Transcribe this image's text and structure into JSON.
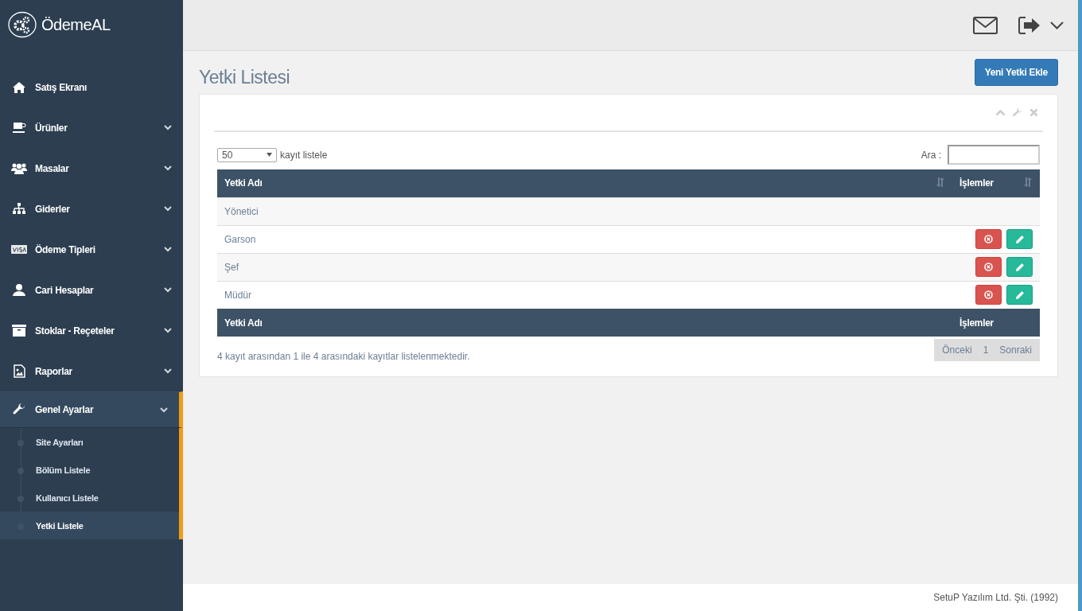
{
  "brand": "ÖdemeAL",
  "sidebar": {
    "items": [
      {
        "label": "Satış Ekranı"
      },
      {
        "label": "Ürünler",
        "expanded": false
      },
      {
        "label": "Masalar",
        "expanded": false
      },
      {
        "label": "Giderler",
        "expanded": false
      },
      {
        "label": "Ödeme Tipleri",
        "expanded": false
      },
      {
        "label": "Cari Hesaplar",
        "expanded": false
      },
      {
        "label": "Stoklar - Reçeteler",
        "expanded": false
      },
      {
        "label": "Raporlar",
        "expanded": false
      },
      {
        "label": "Genel Ayarlar",
        "expanded": true,
        "children": [
          {
            "label": "Site Ayarları",
            "selected": false
          },
          {
            "label": "Bölüm Listele",
            "selected": false
          },
          {
            "label": "Kullanıcı Listele",
            "selected": false
          },
          {
            "label": "Yetki Listele",
            "selected": true
          }
        ]
      }
    ]
  },
  "page_title": "Yetki Listesi",
  "add_button": "Yeni Yetki Ekle",
  "length_select": {
    "value": "50",
    "label": "kayıt listele"
  },
  "search": {
    "label": "Ara :"
  },
  "table": {
    "columns": [
      "Yetki Adı",
      "İşlemler"
    ],
    "rows": [
      {
        "name": "Yönetici",
        "actions": false
      },
      {
        "name": "Garson",
        "actions": true
      },
      {
        "name": "Şef",
        "actions": true
      },
      {
        "name": "Müdür",
        "actions": true
      }
    ],
    "footer": [
      "Yetki Adı",
      "İşlemler"
    ]
  },
  "info": "4 kayıt arasından 1 ile 4 arasındaki kayıtlar listelenmektedir.",
  "pagination": [
    "Önceki",
    "1",
    "Sonraki"
  ],
  "footer": "SetuP Yazılım Ltd. Şti. (1992)"
}
